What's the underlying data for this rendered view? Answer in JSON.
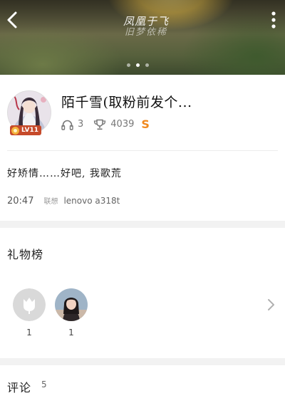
{
  "banner": {
    "title": "凤凰于飞",
    "subtitle": "旧梦依稀",
    "page_dots": 3,
    "active_dot": 2
  },
  "icons": {
    "back": "back-arrow-icon",
    "menu": "more-vertical-icon",
    "listen": "headphones-icon",
    "trophy": "trophy-icon",
    "s_badge": "s-badge-icon",
    "chevron": "chevron-right-icon",
    "gift_placeholder": "tulip-gift-icon"
  },
  "colors": {
    "level_badge": "#c64a2a",
    "s_badge": "#f0891e",
    "gift_placeholder": "#d9d9d9"
  },
  "post": {
    "username": "陌千雪(取粉前发个...",
    "level": "LV11",
    "listen_count": "3",
    "trophy_count": "4039",
    "s_badge": "S",
    "text": "好矫情……好吧, 我歌荒",
    "time": "20:47",
    "device_brand": "联想",
    "device": "lenovo a318t"
  },
  "gifts": {
    "title": "礼物榜",
    "items": [
      {
        "count": "1"
      },
      {
        "count": "1"
      }
    ]
  },
  "comments": {
    "title": "评论",
    "count": "5"
  }
}
